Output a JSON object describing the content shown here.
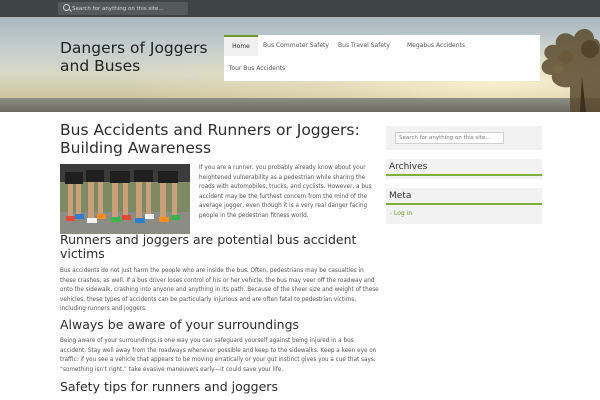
{
  "top_search": {
    "placeholder": "Search for anything on this site..."
  },
  "site": {
    "title": "Dangers of Joggers and Buses"
  },
  "nav": {
    "items": [
      {
        "label": "Home",
        "active": true
      },
      {
        "label": "Bus Commuter Safety",
        "active": false
      },
      {
        "label": "Bus Travel Safety",
        "active": false
      },
      {
        "label": "Megabus Accidents",
        "active": false
      },
      {
        "label": "Tour Bus Accidents",
        "active": false
      }
    ]
  },
  "article": {
    "title": "Bus Accidents and Runners or Joggers: Building Awareness",
    "intro": "If you are a runner, you probably already know about your heightened vulnerability as a pedestrian while sharing the roads with automobiles, trucks, and cyclists. However, a bus accident may be the furthest concern from the mind of the average jogger, even though it is a very real danger facing people in the pedestrian fitness world.",
    "sections": [
      {
        "heading": "Runners and joggers are potential bus accident victims",
        "body": "Bus accidents do not just harm the people who are inside the bus. Often, pedestrians may be casualties in these crashes, as well. If a bus driver loses control of his or her vehicle, the bus may veer off the roadway and onto the sidewalk, crashing into anyone and anything in its path. Because of the sheer size and weight of these vehicles, these types of accidents can be particularly injurious and are often fatal to pedestrian victims, including runners and joggers."
      },
      {
        "heading": "Always be aware of your surroundings",
        "body": "Being aware of your surroundings is one way you can safeguard yourself against being injured in a bus accident. Stay well away from the roadways whenever possible and keep to the sidewalks. Keep a keen eye on traffic: if you see a vehicle that appears to be moving erratically or your gut instinct gives you a cue that says, “something isn’t right,” take evasive maneuvers early—it could save your life."
      },
      {
        "heading": "Safety tips for runners and joggers",
        "body": ""
      }
    ]
  },
  "sidebar": {
    "search_placeholder": "Search for anything on this site...",
    "archives_title": "Archives",
    "meta_title": "Meta",
    "meta_links": [
      "Log in"
    ]
  },
  "colors": {
    "accent": "#7fb03a",
    "link": "#6f9a2d",
    "topbar": "#3f4447"
  },
  "icons": {
    "search": "search-icon",
    "bullet": "chevron-right-icon"
  }
}
